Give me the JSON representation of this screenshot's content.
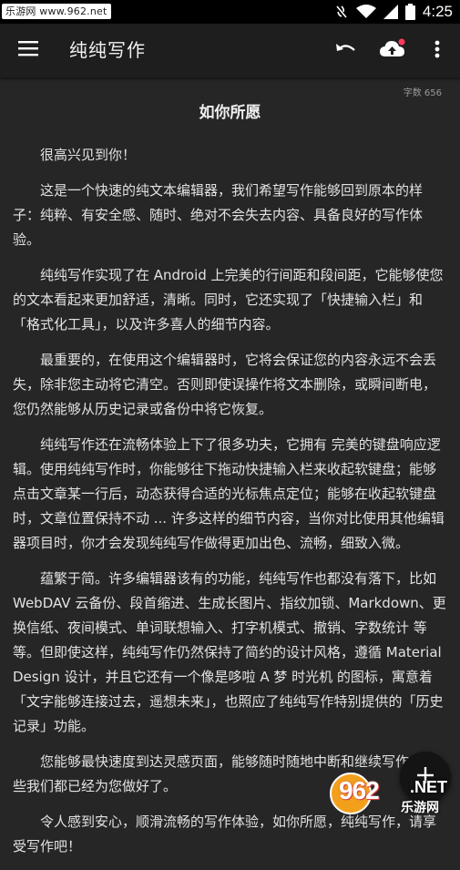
{
  "status_bar": {
    "watermark": "乐游网 www.962.net",
    "time": "4:25"
  },
  "toolbar": {
    "title": "纯纯写作",
    "icons": [
      "menu-icon",
      "undo-icon",
      "cloud-upload-icon",
      "more-vert-icon"
    ]
  },
  "document": {
    "word_count": "字数 656",
    "title": "如你所愿",
    "paragraphs": [
      "很高兴见到你！",
      "这是一个快速的纯文本编辑器，我们希望写作能够回到原本的样子：纯粹、有安全感、随时、绝对不会失去内容、具备良好的写作体验。",
      "纯纯写作实现了在 Android 上完美的行间距和段间距，它能够使您的文本看起来更加舒适，清晰。同时，它还实现了「快捷输入栏」和「格式化工具」，以及许多喜人的细节内容。",
      "最重要的，在使用这个编辑器时，它将会保证您的内容永远不会丢失，除非您主动将它清空。否则即使误操作将文本删除，或瞬间断电，您仍然能够从历史记录或备份中将它恢复。",
      "纯纯写作还在流畅体验上下了很多功夫，它拥有 完美的键盘响应逻辑。使用纯纯写作时，你能够往下拖动快捷输入栏来收起软键盘；能够点击文章某一行后，动态获得合适的光标焦点定位；能够在收起软键盘时，文章位置保持不动 ... 许多这样的细节内容，当你对比使用其他编辑器项目时，你才会发现纯纯写作做得更加出色、流畅，细致入微。",
      "蕴繁于简。许多编辑器该有的功能，纯纯写作也都没有落下，比如 WebDAV 云备份、段首缩进、生成长图片、指纹加锁、Markdown、更换信纸、夜间模式、单词联想输入、打字机模式、撤销、字数统计 等等。但即使这样，纯纯写作仍然保持了简约的设计风格，遵循 Material Design 设计，并且它还有一个像是哆啦 A 梦 时光机 的图标，寓意着「文字能够连接过去，遥想未来」，也照应了纯纯写作特别提供的「历史记录」功能。",
      "您能够最快速度到达灵感页面，能够随时随地中断和继续写作，这些我们都已经为您做好了。",
      "令人感到安心，顺滑流畅的写作体验，如你所愿，纯纯写作，请享受写作吧！"
    ]
  },
  "fab": {
    "icon": "add-icon"
  },
  "watermark_bottom": {
    "number": "962",
    "net": ".NET",
    "site": "乐游网"
  }
}
